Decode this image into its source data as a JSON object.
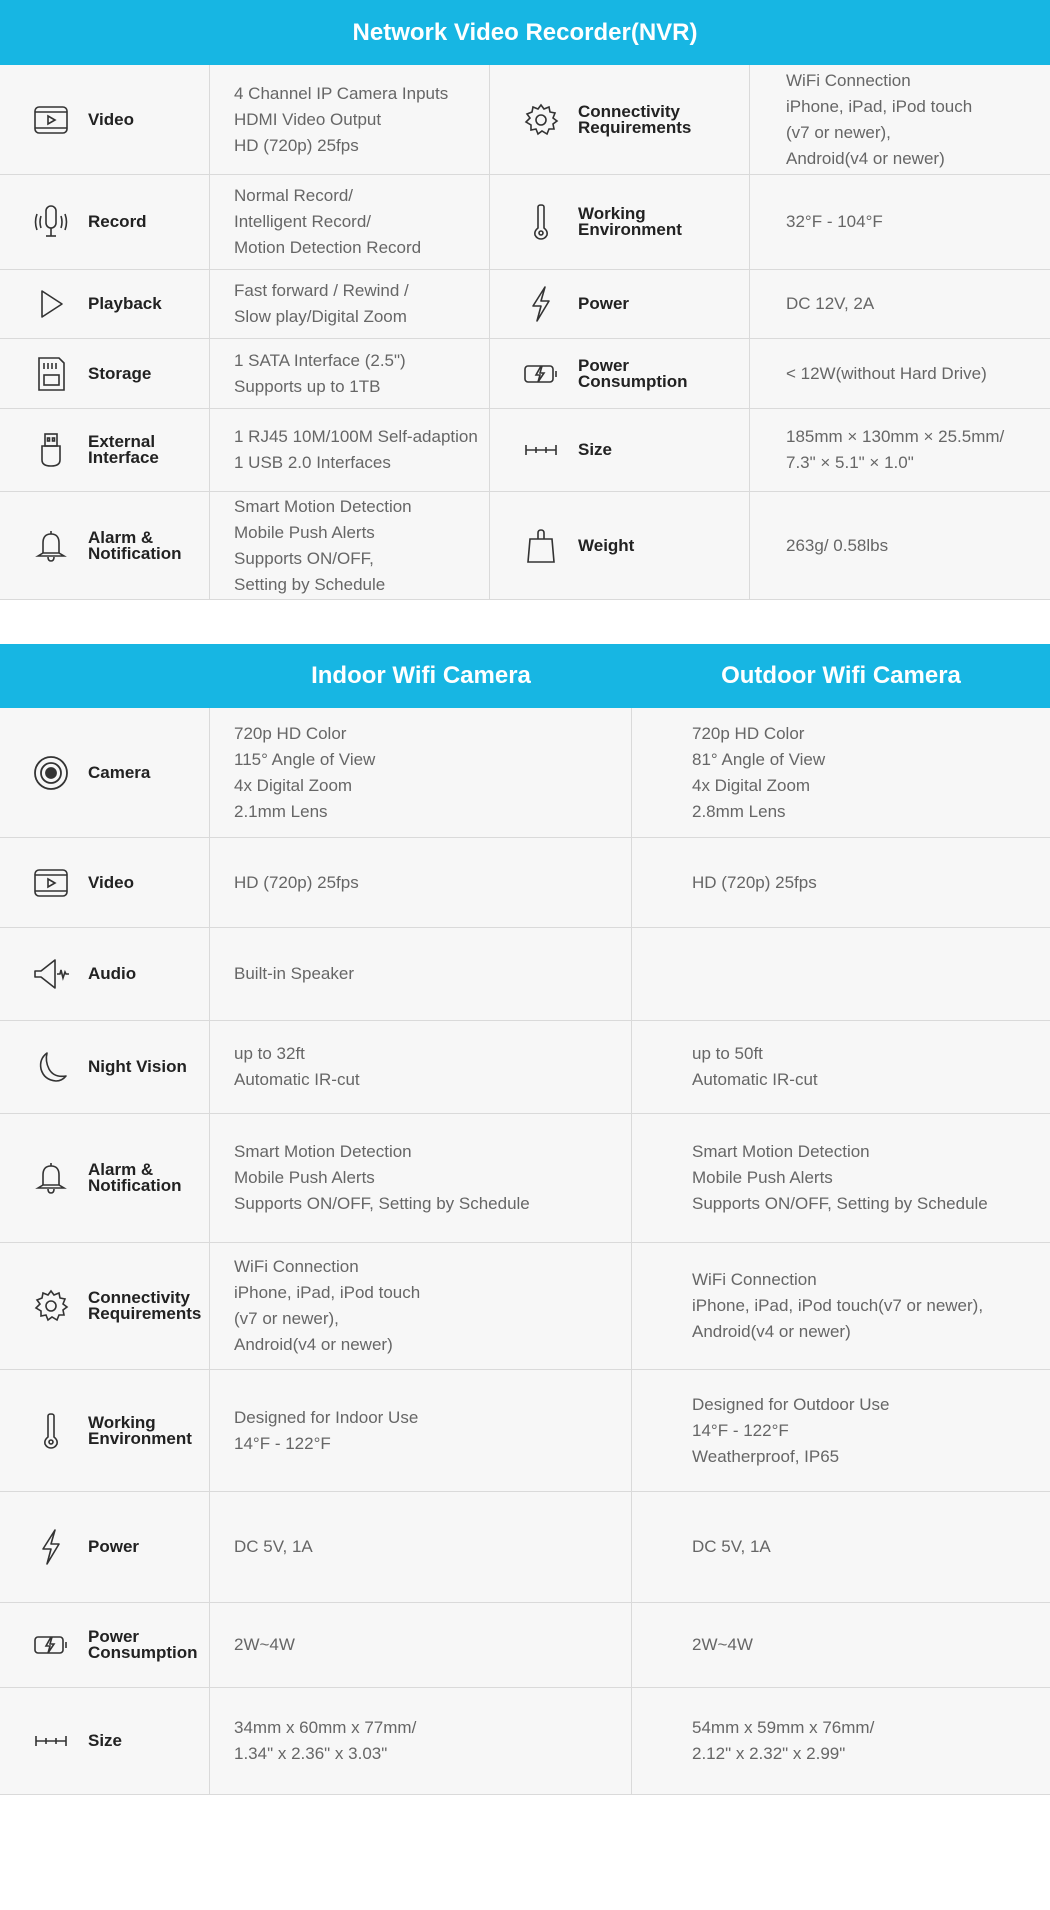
{
  "nvr": {
    "title": "Network Video Recorder(NVR)",
    "rows": [
      {
        "left_label": "Video",
        "left_icon": "video-icon",
        "left_lines": [
          "4 Channel IP Camera Inputs",
          "HDMI Video Output",
          "HD (720p) 25fps"
        ],
        "right_label": "Connectivity\nRequirements",
        "right_icon": "gear-icon",
        "right_lines": [
          "WiFi Connection",
          "iPhone, iPad, iPod touch",
          "(v7 or newer),",
          "Android(v4 or newer)"
        ]
      },
      {
        "left_label": "Record",
        "left_icon": "microphone-icon",
        "left_lines": [
          "Normal Record/",
          "Intelligent Record/",
          "Motion Detection Record"
        ],
        "right_label": "Working\nEnvironment",
        "right_icon": "thermometer-icon",
        "right_lines": [
          "32°F - 104°F"
        ]
      },
      {
        "left_label": "Playback",
        "left_icon": "play-icon",
        "left_lines": [
          "Fast forward / Rewind /",
          "Slow play/Digital Zoom"
        ],
        "right_label": "Power",
        "right_icon": "lightning-icon",
        "right_lines": [
          "DC 12V, 2A"
        ]
      },
      {
        "left_label": "Storage",
        "left_icon": "sd-card-icon",
        "left_lines": [
          "1 SATA Interface (2.5\")",
          "Supports up to 1TB"
        ],
        "right_label": "Power\nConsumption",
        "right_icon": "battery-charging-icon",
        "right_lines": [
          "< 12W(without Hard Drive)"
        ]
      },
      {
        "left_label": "External\nInterface",
        "left_icon": "usb-icon",
        "left_lines": [
          "1 RJ45 10M/100M Self-adaption",
          "1 USB 2.0 Interfaces"
        ],
        "right_label": "Size",
        "right_icon": "ruler-icon",
        "right_lines": [
          "185mm × 130mm × 25.5mm/",
          "7.3\" × 5.1\" × 1.0\""
        ]
      },
      {
        "left_label": "Alarm &\nNotification",
        "left_icon": "bell-icon",
        "left_lines": [
          "Smart Motion Detection",
          "Mobile Push Alerts",
          "Supports ON/OFF,",
          "Setting by Schedule"
        ],
        "right_label": "Weight",
        "right_icon": "weight-icon",
        "right_lines": [
          "263g/ 0.58lbs"
        ]
      }
    ]
  },
  "cameras": {
    "indoor_title": "Indoor Wifi Camera",
    "outdoor_title": "Outdoor Wifi Camera",
    "rows": [
      {
        "label": "Camera",
        "icon": "camera-lens-icon",
        "indoor": [
          "720p HD Color",
          "115° Angle of View",
          "4x Digital Zoom",
          "2.1mm Lens"
        ],
        "outdoor": [
          "720p HD Color",
          "81° Angle of View",
          "4x Digital Zoom",
          "2.8mm Lens"
        ]
      },
      {
        "label": "Video",
        "icon": "video-icon",
        "indoor": [
          "HD (720p) 25fps"
        ],
        "outdoor": [
          "HD (720p) 25fps"
        ]
      },
      {
        "label": "Audio",
        "icon": "speaker-icon",
        "indoor": [
          "Built-in Speaker"
        ],
        "outdoor": []
      },
      {
        "label": "Night Vision",
        "icon": "moon-icon",
        "indoor": [
          "up to 32ft",
          "Automatic IR-cut"
        ],
        "outdoor": [
          "up to 50ft",
          "Automatic IR-cut"
        ]
      },
      {
        "label": "Alarm &\nNotification",
        "icon": "bell-icon",
        "indoor": [
          "Smart Motion Detection",
          "Mobile Push Alerts",
          "Supports ON/OFF, Setting by Schedule"
        ],
        "outdoor": [
          "Smart Motion Detection",
          "Mobile Push Alerts",
          "Supports ON/OFF, Setting by Schedule"
        ]
      },
      {
        "label": "Connectivity\nRequirements",
        "icon": "gear-icon",
        "indoor": [
          "WiFi Connection",
          "iPhone, iPad, iPod touch",
          "(v7 or newer),",
          "Android(v4 or newer)"
        ],
        "outdoor": [
          "WiFi Connection",
          "iPhone, iPad, iPod touch(v7 or newer),",
          "Android(v4 or newer)"
        ]
      },
      {
        "label": "Working\nEnvironment",
        "icon": "thermometer-icon",
        "indoor": [
          "Designed for Indoor Use",
          "14°F - 122°F"
        ],
        "outdoor": [
          "Designed for Outdoor Use",
          "14°F - 122°F",
          "Weatherproof, IP65"
        ]
      },
      {
        "label": "Power",
        "icon": "lightning-icon",
        "indoor": [
          "DC 5V, 1A"
        ],
        "outdoor": [
          "DC 5V, 1A"
        ]
      },
      {
        "label": "Power\nConsumption",
        "icon": "battery-charging-icon",
        "indoor": [
          "2W~4W"
        ],
        "outdoor": [
          "2W~4W"
        ]
      },
      {
        "label": "Size",
        "icon": "ruler-icon",
        "indoor": [
          "34mm x 60mm x 77mm/",
          "1.34\" x 2.36\" x 3.03\""
        ],
        "outdoor": [
          "54mm x 59mm x 76mm/",
          "2.12\" x 2.32\" x 2.99\""
        ]
      }
    ]
  }
}
